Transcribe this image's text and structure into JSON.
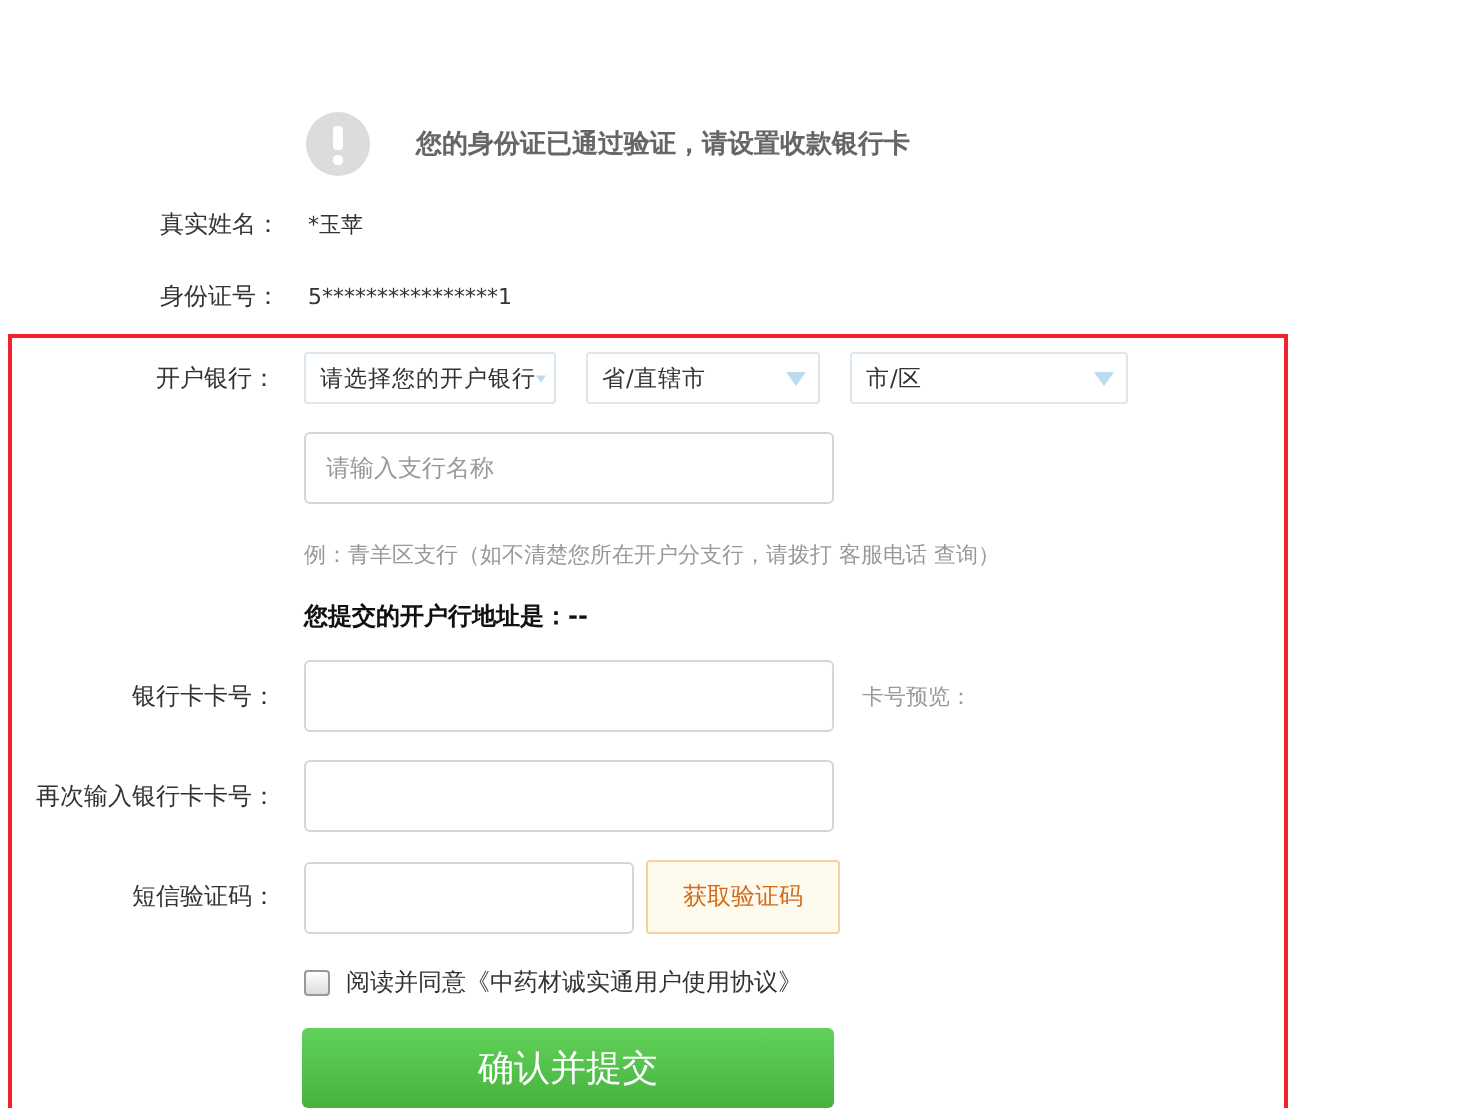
{
  "notice": {
    "text": "您的身份证已通过验证，请设置收款银行卡"
  },
  "info": [
    {
      "label": "真实姓名：",
      "value": "*玉苹"
    },
    {
      "label": "身份证号：",
      "value": "5****************1"
    }
  ],
  "bank": {
    "label": "开户银行：",
    "selects": [
      {
        "text": "请选择您的开户银行"
      },
      {
        "text": "省/直辖市"
      },
      {
        "text": "市/区"
      }
    ],
    "branch": {
      "placeholder": "请输入支行名称"
    },
    "hint": "例：青羊区支行（如不清楚您所在开户分支行，请拨打 客服电话 查询）",
    "address": "您提交的开户行地址是：--"
  },
  "card": {
    "label": "银行卡卡号：",
    "preview": "卡号预览："
  },
  "card_confirm": {
    "label": "再次输入银行卡卡号："
  },
  "sms": {
    "label": "短信验证码：",
    "button": "获取验证码"
  },
  "agreement": {
    "checked": false,
    "text": "阅读并同意《中药材诚实通用户使用协议》"
  },
  "submit": "确认并提交"
}
